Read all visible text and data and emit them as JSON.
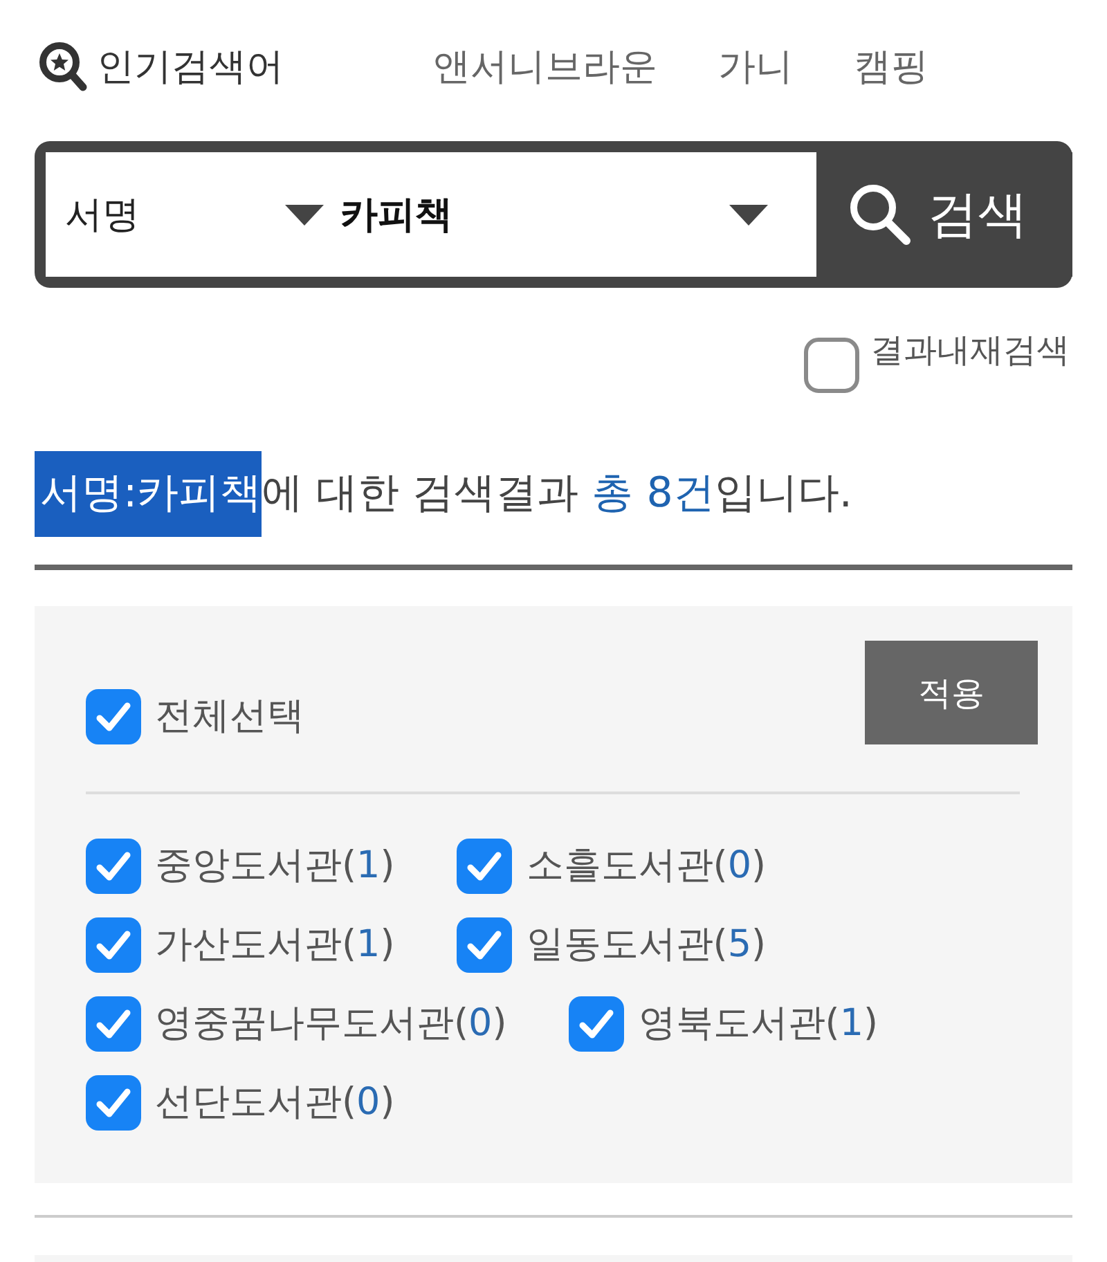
{
  "popular": {
    "label": "인기검색어",
    "keywords": [
      "앤서니브라운",
      "가니",
      "캠핑"
    ]
  },
  "search": {
    "field": "서명",
    "value": "카피책",
    "button": "검색"
  },
  "search_within": {
    "label": "결과내재검색",
    "checked": false
  },
  "result": {
    "query": "서명:카피책",
    "text": "에 대한 검색결과 ",
    "count": "총 8건",
    "suffix": "입니다."
  },
  "filter": {
    "select_all": {
      "label": "전체선택",
      "checked": true
    },
    "apply": "적용",
    "libraries": [
      {
        "name": "중앙도서관",
        "count": "(1)",
        "checked": true
      },
      {
        "name": "소흘도서관",
        "count": "(0)",
        "checked": true
      },
      {
        "name": "가산도서관",
        "count": "(1)",
        "checked": true
      },
      {
        "name": "일동도서관",
        "count": "(5)",
        "checked": true
      },
      {
        "name": "영중꿈나무도서관",
        "count": "(0)",
        "checked": true
      },
      {
        "name": "영북도서관",
        "count": "(1)",
        "checked": true
      },
      {
        "name": "선단도서관",
        "count": "(0)",
        "checked": true
      }
    ]
  }
}
